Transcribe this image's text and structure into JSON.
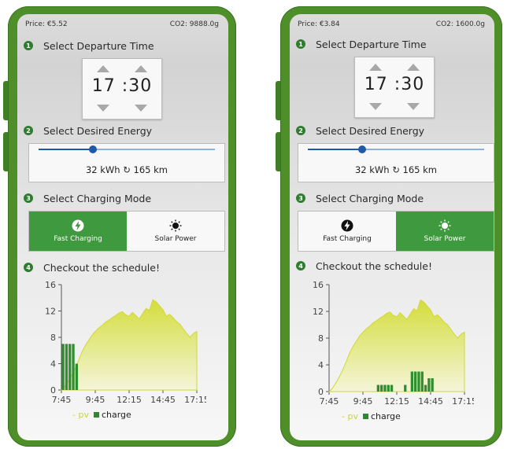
{
  "screens": [
    {
      "price": "Price: €5.52",
      "co2": "CO2: 9888.0g",
      "steps": [
        "Select Departure Time",
        "Select Desired Energy",
        "Select Charging Mode",
        "Checkout the schedule!"
      ],
      "step_numbers": [
        "1",
        "2",
        "3",
        "4"
      ],
      "time_hour": "17",
      "time_minute": "30",
      "energy_text": "32 kWh ↻ 165 km",
      "energy_slider_fraction": 0.31,
      "modes": [
        {
          "label": "Fast Charging",
          "icon": "lightning-icon"
        },
        {
          "label": "Solar Power",
          "icon": "sun-icon"
        }
      ],
      "active_mode": 0,
      "legend": {
        "pv": "pv",
        "charge": "charge"
      },
      "chart_data": {
        "type": "area",
        "x_ticks": [
          "7:45",
          "9:45",
          "12:15",
          "14:45",
          "17:15"
        ],
        "y_ticks": [
          "0",
          "4",
          "8",
          "12",
          "16"
        ],
        "ylim": [
          0,
          16
        ],
        "series": [
          {
            "name": "pv",
            "x": [
              0,
              1,
              2,
              3,
              4,
              5,
              6,
              7,
              8,
              9,
              10,
              11,
              12,
              13,
              14,
              15,
              16,
              17,
              18,
              19,
              20,
              21,
              22,
              23,
              24,
              25,
              26,
              27,
              28,
              29,
              30,
              31,
              32,
              33,
              34,
              35,
              36,
              37,
              38,
              39,
              40
            ],
            "values": [
              0,
              0.5,
              1.3,
              2.2,
              3.2,
              4.4,
              5.7,
              6.7,
              7.5,
              8.3,
              8.9,
              9.4,
              9.8,
              10.3,
              10.6,
              11.0,
              11.3,
              11.7,
              11.9,
              11.4,
              11.2,
              11.8,
              11.3,
              10.8,
              11.6,
              12.4,
              12.1,
              13.7,
              13.4,
              12.8,
              12.2,
              11.2,
              11.5,
              11.0,
              10.4,
              10.0,
              9.3,
              8.6,
              8.0,
              8.6,
              8.9
            ]
          },
          {
            "name": "charge",
            "x": [
              0,
              1,
              2,
              3,
              4
            ],
            "values": [
              7,
              7,
              7,
              7,
              4
            ]
          }
        ]
      }
    },
    {
      "price": "Price: €3.84",
      "co2": "CO2: 1600.0g",
      "steps": [
        "Select Departure Time",
        "Select Desired Energy",
        "Select Charging Mode",
        "Checkout the schedule!"
      ],
      "step_numbers": [
        "1",
        "2",
        "3",
        "4"
      ],
      "time_hour": "17",
      "time_minute": "30",
      "energy_text": "32 kWh ↻ 165 km",
      "energy_slider_fraction": 0.31,
      "modes": [
        {
          "label": "Fast Charging",
          "icon": "lightning-icon"
        },
        {
          "label": "Solar Power",
          "icon": "sun-icon"
        }
      ],
      "active_mode": 1,
      "legend": {
        "pv": "pv",
        "charge": "charge"
      },
      "chart_data": {
        "type": "area",
        "x_ticks": [
          "7:45",
          "9:45",
          "12:15",
          "14:45",
          "17:15"
        ],
        "y_ticks": [
          "0",
          "4",
          "8",
          "12",
          "16"
        ],
        "ylim": [
          0,
          16
        ],
        "series": [
          {
            "name": "pv",
            "x": [
              0,
              1,
              2,
              3,
              4,
              5,
              6,
              7,
              8,
              9,
              10,
              11,
              12,
              13,
              14,
              15,
              16,
              17,
              18,
              19,
              20,
              21,
              22,
              23,
              24,
              25,
              26,
              27,
              28,
              29,
              30,
              31,
              32,
              33,
              34,
              35,
              36,
              37,
              38,
              39,
              40
            ],
            "values": [
              0,
              0.5,
              1.3,
              2.2,
              3.2,
              4.4,
              5.7,
              6.7,
              7.5,
              8.3,
              8.9,
              9.4,
              9.8,
              10.3,
              10.6,
              11.0,
              11.3,
              11.7,
              11.9,
              11.4,
              11.2,
              11.8,
              11.3,
              10.8,
              11.6,
              12.4,
              12.1,
              13.7,
              13.4,
              12.8,
              12.2,
              11.2,
              11.5,
              11.0,
              10.4,
              10.0,
              9.3,
              8.6,
              8.0,
              8.6,
              8.9
            ]
          },
          {
            "name": "charge",
            "x": [
              14,
              15,
              16,
              17,
              18,
              19,
              20,
              21,
              22,
              23,
              24,
              25,
              26,
              27,
              28,
              29,
              30
            ],
            "values": [
              1,
              1,
              1,
              1,
              1,
              0,
              0,
              0,
              1,
              0,
              3,
              3,
              3,
              3,
              1,
              2,
              2
            ]
          }
        ]
      }
    }
  ]
}
